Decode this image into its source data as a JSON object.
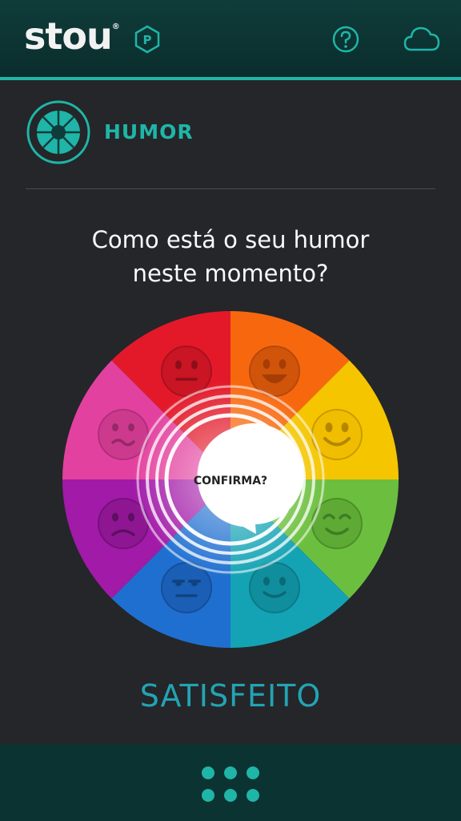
{
  "app": {
    "logo_text": "stou",
    "logo_mark": "®",
    "badge_letter": "P"
  },
  "header": {
    "icons": [
      "p-badge-icon",
      "help-icon",
      "cloud-icon"
    ]
  },
  "section": {
    "title": "HUMOR",
    "icon": "humor-wheel-icon"
  },
  "question": {
    "line1": "Como está o seu humor",
    "line2": "neste momento?"
  },
  "mood_wheel": {
    "center_label": "CONFIRMA?",
    "selected": "SATISFEITO",
    "segments": [
      {
        "color": "#f7680e",
        "face": "laughing"
      },
      {
        "color": "#f5c500",
        "face": "happy"
      },
      {
        "color": "#6cbf3e",
        "face": "content"
      },
      {
        "color": "#13a3b4",
        "face": "satisfied"
      },
      {
        "color": "#1f6fd0",
        "face": "bored"
      },
      {
        "color": "#a21aa8",
        "face": "sad"
      },
      {
        "color": "#e3419f",
        "face": "worried"
      },
      {
        "color": "#e3192a",
        "face": "neutral"
      }
    ]
  },
  "footer": {
    "menu_icon": "grid-menu-icon"
  },
  "colors": {
    "accent": "#1fb5a8",
    "background": "#242629",
    "topbar": "#0b3332",
    "selected_text": "#22a4b5"
  }
}
